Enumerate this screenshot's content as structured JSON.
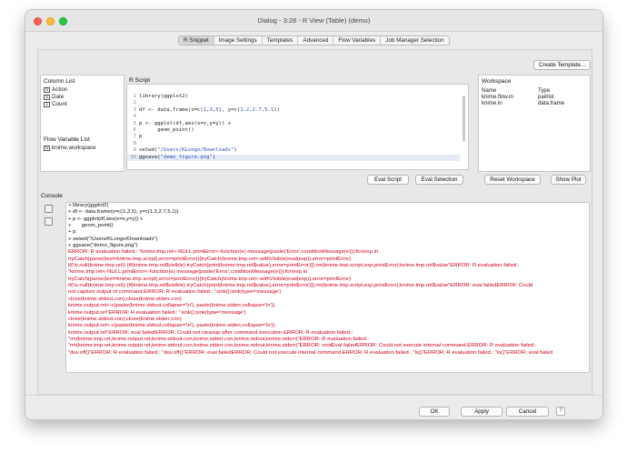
{
  "window": {
    "title": "Dialog - 3:28 - R View (Table) (demo)"
  },
  "tabs": [
    {
      "label": "R Snippet",
      "active": true
    },
    {
      "label": "Image Settings"
    },
    {
      "label": "Templates"
    },
    {
      "label": "Advanced"
    },
    {
      "label": "Flow Variables"
    },
    {
      "label": "Job Manager Selection"
    }
  ],
  "toolbar": {
    "create_template": "Create Template..."
  },
  "column_list": {
    "title": "Column List",
    "items": [
      {
        "icon": "S",
        "label": "Action"
      },
      {
        "icon": "S",
        "label": "Date"
      },
      {
        "icon": "I",
        "label": "Count"
      }
    ]
  },
  "flow_variable_list": {
    "title": "Flow Variable List",
    "items": [
      {
        "icon": "S",
        "label": "knime.workspace"
      }
    ]
  },
  "r_script": {
    "title": "R Script",
    "lines": [
      "library(ggplot2)",
      "",
      "df <- data.frame(x=c(1,3,5), y=c(1.2,2.7,5.1))",
      "",
      "p <- ggplot(df,aes(x=x,y=y)) +",
      "      geom_point()",
      "p",
      "",
      "setwd(\"/Users/KLongo/Downloads\")",
      "ggsave(\"demo_figure.png\")"
    ],
    "eval_script": "Eval Script",
    "eval_selection": "Eval Selection"
  },
  "workspace": {
    "title": "Workspace",
    "headers": [
      "Name",
      "Type"
    ],
    "rows": [
      [
        "knime.flow.in",
        "pairlist"
      ],
      [
        "knime.in",
        "data.frame"
      ]
    ],
    "reset_button": "Reset Workspace",
    "show_plot_button": "Show Plot"
  },
  "console": {
    "title": "Console",
    "lines": [
      {
        "t": "> library(ggplot2)",
        "err": false
      },
      {
        "t": "+ df <- data.frame(x=c(1,3,5), y=c(1.2,2.7,5.1))",
        "err": false
      },
      {
        "t": "+ p <- ggplot(df,aes(x=x,y=y)) +",
        "err": false
      },
      {
        "t": "+       geom_point()",
        "err": false
      },
      {
        "t": "+ p",
        "err": false
      },
      {
        "t": "+ setwd(\"/Users/KLongo/Downloads\")",
        "err": false
      },
      {
        "t": "+ ggsave(\"demo_figure.png\")",
        "err": false
      },
      {
        "t": "ERROR: R evaluation failed.: \"knime.tmp.ret<-NULL;printError<-function(e) message(paste('Error',conditionMessage(e)));for(exp in",
        "err": true
      },
      {
        "t": "tryCatch(parse(text=knime.tmp.script),error=printError)){tryCatch(knime.tmp.ret<-withVisible(eval(exp)),error=printError)",
        "err": true
      },
      {
        "t": "if(!is.null(knime.tmp.ret)) {if(knime.tmp.ret$visible) tryCatch(print(knime.tmp.ret$value),error=printError)}};rm(knime.tmp.script,exp,printError);knime.tmp.ret$value\"ERROR: R evaluation failed.:",
        "err": true
      },
      {
        "t": "\"knime.tmp.ret<-NULL;printError<-function(e) message(paste('Error',conditionMessage(e)));for(exp in",
        "err": true
      },
      {
        "t": "tryCatch(parse(text=knime.tmp.script),error=printError)){tryCatch(knime.tmp.ret<-withVisible(eval(exp)),error=printError)",
        "err": true
      },
      {
        "t": "if(!is.null(knime.tmp.ret)) {if(knime.tmp.ret$visible) tryCatch(print(knime.tmp.ret$value),error=printError)}};rm(knime.tmp.script,exp,printError);knime.tmp.ret$value\"ERROR: eval failedERROR: Could",
        "err": true
      },
      {
        "t": "not capture output of command.ERROR: R evaluation failed.: \"sink();sink(type='message')",
        "err": true
      },
      {
        "t": "close(knime.stdout.con);close(knime.stderr.con)",
        "err": true
      },
      {
        "t": "knime.output.ret<-c(paste(knime.stdout,collapse='\\n'), paste(knime.stderr,collapse='\\n'))",
        "err": true
      },
      {
        "t": "knime.output.ret\"ERROR: R evaluation failed.: \"sink();sink(type='message')",
        "err": true
      },
      {
        "t": "close(knime.stdout.con);close(knime.stderr.con)",
        "err": true
      },
      {
        "t": "knime.output.ret<-c(paste(knime.stdout,collapse='\\n'), paste(knime.stderr,collapse='\\n'))",
        "err": true
      },
      {
        "t": "knime.output.ret\"ERROR: eval failedERROR: Could not cleanup after command execution.ERROR: R evaluation failed.:",
        "err": true
      },
      {
        "t": "\"rm(knime.tmp.ret,knime.output.ret,knime.stdout.con,knime.stderr.con,knime.stdout,knime.stderr)\"ERROR: R evaluation failed.:",
        "err": true
      },
      {
        "t": "\"rm(knime.tmp.ret,knime.output.ret,knime.stdout.con,knime.stderr.con,knime.stdout,knime.stderr)\"ERROR: voidEval failedERROR: Could not execute internal command.ERROR: R evaluation failed.:",
        "err": true
      },
      {
        "t": "\"dev.off()\"ERROR: R evaluation failed.: \"dev.off()\"ERROR: eval failedERROR: Could not execute internal command.ERROR: R evaluation failed.: \"ls()\"ERROR: R evaluation failed.: \"ls()\"ERROR: eval failed",
        "err": true
      }
    ]
  },
  "footer": {
    "ok": "OK",
    "apply": "Apply",
    "cancel": "Cancel",
    "help": "?"
  }
}
